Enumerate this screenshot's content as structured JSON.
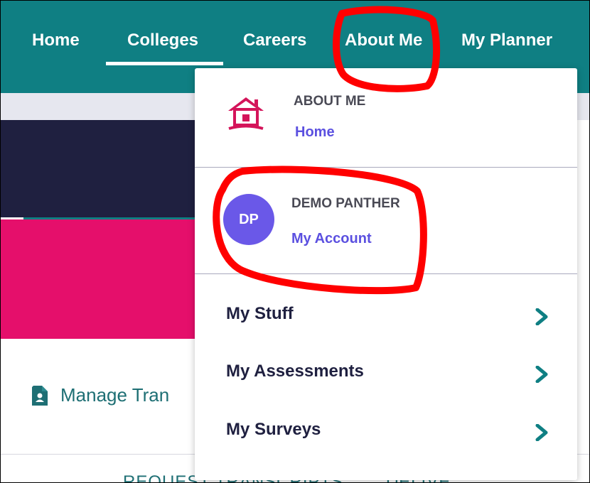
{
  "nav": {
    "items": [
      "Home",
      "Colleges",
      "Careers",
      "About Me",
      "My Planner"
    ],
    "active": "Colleges"
  },
  "dropdown": {
    "about": {
      "title": "ABOUT ME",
      "link": "Home",
      "icon": "house-icon"
    },
    "account": {
      "name": "DEMO PANTHER",
      "initials": "DP",
      "link": "My Account"
    },
    "items": [
      {
        "label": "My Stuff",
        "icon": "chevron-right-icon"
      },
      {
        "label": "My Assessments",
        "icon": "chevron-right-icon"
      },
      {
        "label": "My Surveys",
        "icon": "chevron-right-icon"
      }
    ]
  },
  "background": {
    "manage_label": "Manage Tran",
    "bottom_label": "REQUEST TRANSCRIPTS",
    "bottom_label_2": "DELIVE"
  },
  "colors": {
    "nav_bg": "#0f7f83",
    "accent_pink": "#e50f6b",
    "navy": "#1f2040",
    "link": "#5b50e0",
    "avatar": "#6a58e8",
    "annotation": "#ff0000"
  }
}
